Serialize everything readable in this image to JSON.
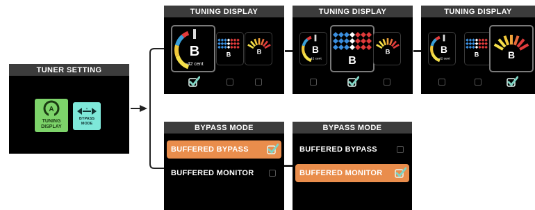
{
  "tuner_setting": {
    "title": "TUNER SETTING",
    "tiles": [
      {
        "label_line1": "TUNING",
        "label_line2": "DISPLAY",
        "icon": "tuner-gauge-icon",
        "selected": true,
        "color": "#7dd36a"
      },
      {
        "label_line1": "BYPASS",
        "label_line2": "MODE",
        "icon": "bypass-arrows-icon",
        "selected": false,
        "color": "#7ee8d9"
      }
    ]
  },
  "tuning_display": {
    "panels": [
      {
        "title": "TUNING DISPLAY",
        "selected_index": 0
      },
      {
        "title": "TUNING DISPLAY",
        "selected_index": 1
      },
      {
        "title": "TUNING DISPLAY",
        "selected_index": 2
      }
    ],
    "reading": "-42",
    "reading_unit": "cent",
    "note": "B",
    "note_suffix": "b"
  },
  "bypass_mode": {
    "panels": [
      {
        "title": "BYPASS MODE",
        "options": [
          "BUFFERED BYPASS",
          "BUFFERED MONITOR"
        ],
        "selected_index": 0
      },
      {
        "title": "BYPASS MODE",
        "options": [
          "BUFFERED BYPASS",
          "BUFFERED MONITOR"
        ],
        "selected_index": 1
      }
    ]
  },
  "colors": {
    "accent_orange": "#e98d4c",
    "check_teal": "#7fd3c3",
    "tile_green": "#7dd36a",
    "tile_teal": "#7ee8d9"
  }
}
